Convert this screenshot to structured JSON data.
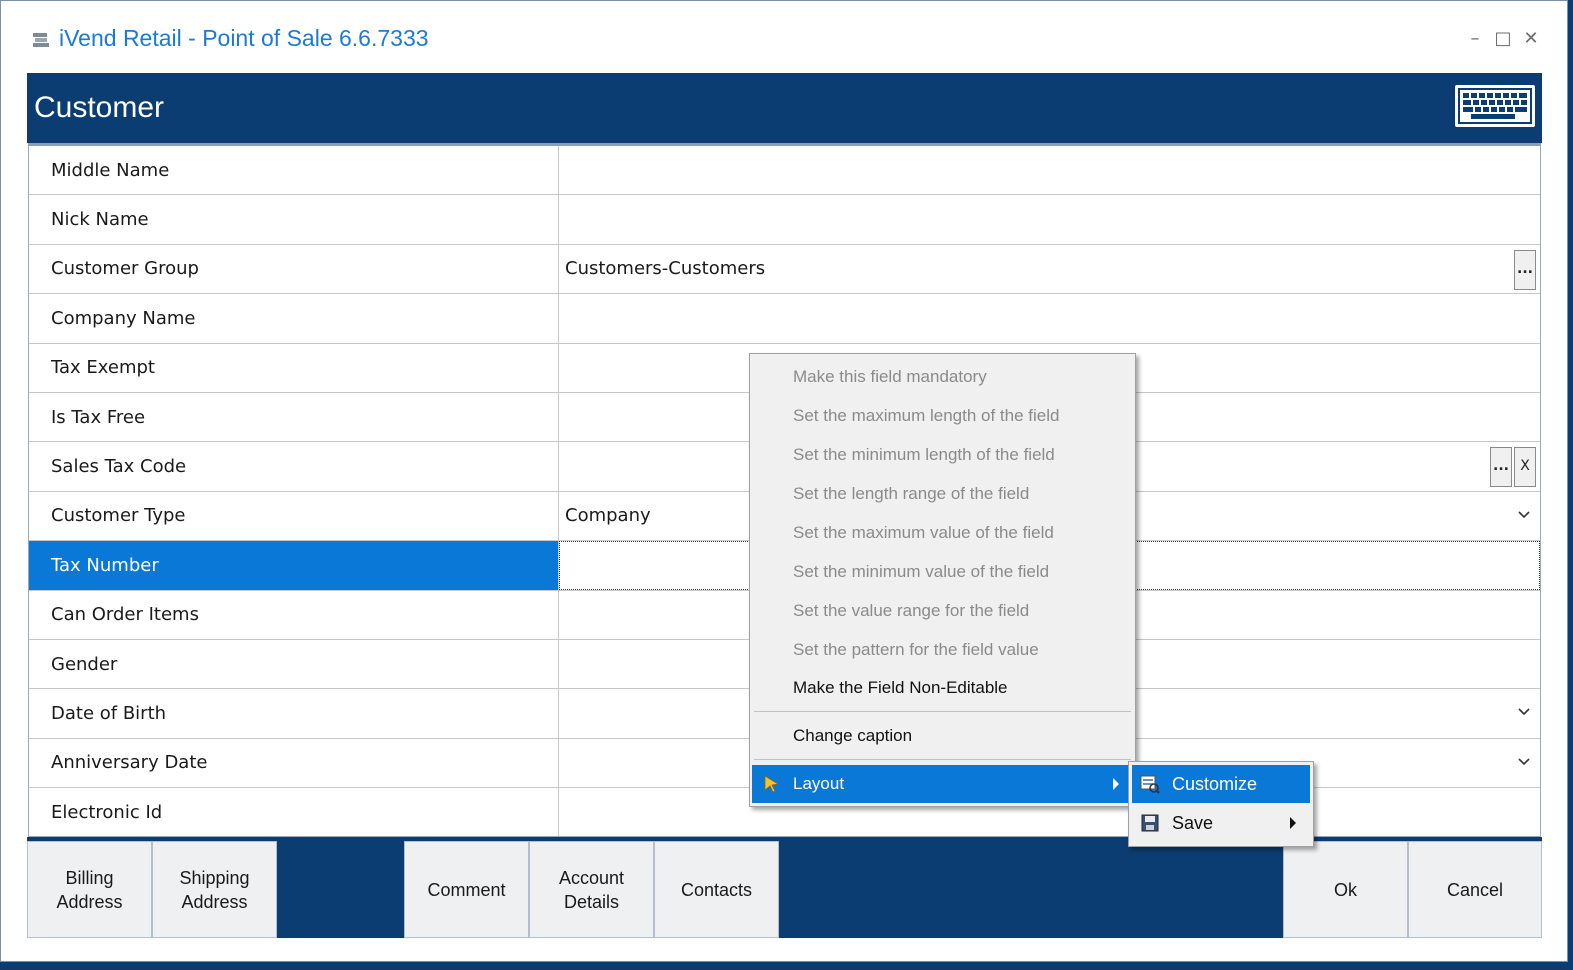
{
  "window": {
    "title": "iVend Retail - Point of Sale 6.6.7333"
  },
  "header": {
    "title": "Customer"
  },
  "fields": [
    {
      "label": "Middle Name",
      "value": ""
    },
    {
      "label": "Nick Name",
      "value": ""
    },
    {
      "label": "Customer Group",
      "value": "Customers-Customers"
    },
    {
      "label": "Company Name",
      "value": ""
    },
    {
      "label": "Tax Exempt",
      "value": ""
    },
    {
      "label": "Is Tax Free",
      "value": ""
    },
    {
      "label": "Sales Tax Code",
      "value": ""
    },
    {
      "label": "Customer Type",
      "value": "Company"
    },
    {
      "label": "Tax Number",
      "value": ""
    },
    {
      "label": "Can Order Items",
      "value": ""
    },
    {
      "label": "Gender",
      "value": ""
    },
    {
      "label": "Date of Birth",
      "value": ""
    },
    {
      "label": "Anniversary Date",
      "value": ""
    },
    {
      "label": "Electronic Id",
      "value": ""
    }
  ],
  "buttons": {
    "ellipsis": "...",
    "clear": "X",
    "billing_line1": "Billing",
    "billing_line2": "Address",
    "shipping_line1": "Shipping",
    "shipping_line2": "Address",
    "comment": "Comment",
    "account_line1": "Account",
    "account_line2": "Details",
    "contacts": "Contacts",
    "ok": "Ok",
    "cancel": "Cancel"
  },
  "context_menu": {
    "items": [
      "Make this field mandatory",
      "Set the maximum length of the field",
      "Set the minimum length of the field",
      "Set the length range of the field",
      "Set the maximum value of the field",
      "Set the minimum value of the field",
      "Set the value range for the field",
      "Set the pattern for the field value",
      "Make the Field Non-Editable",
      "Change caption",
      "Layout"
    ],
    "submenu": [
      "Customize",
      "Save"
    ]
  },
  "colors": {
    "header": "#0b3d73",
    "selection": "#0a78d7",
    "title": "#1a7bd4"
  }
}
